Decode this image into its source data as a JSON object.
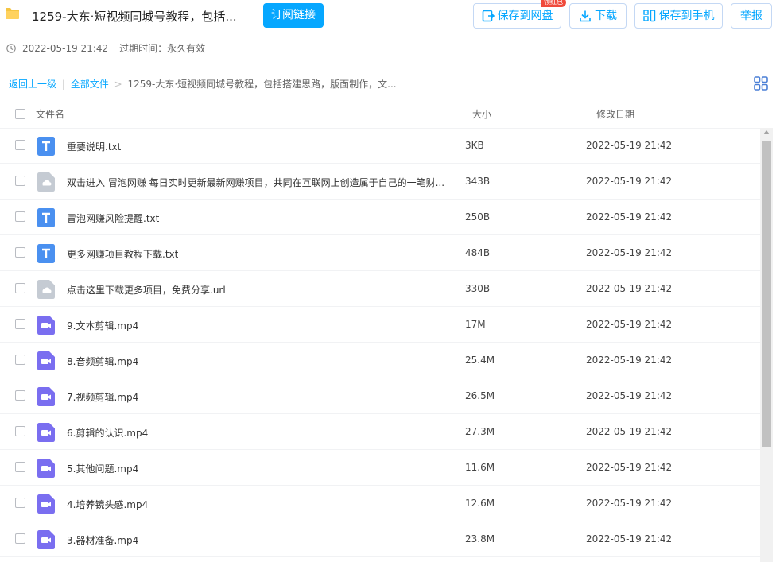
{
  "header": {
    "title": "1259-大东·短视频同城号教程，包括...",
    "subscribe_label": "订阅链接",
    "save_to_disk_label": "保存到网盘",
    "badge_label": "领红包",
    "download_label": "下载",
    "save_to_phone_label": "保存到手机",
    "report_label": "举报",
    "date": "2022-05-19 21:42",
    "expiry": "过期时间：永久有效"
  },
  "breadcrumb": {
    "back": "返回上一级",
    "separator_bar": "|",
    "all_files": "全部文件",
    "arrow": ">",
    "current": "1259-大东·短视频同城号教程，包括搭建思路，版面制作，文..."
  },
  "table": {
    "col_name": "文件名",
    "col_size": "大小",
    "col_date": "修改日期",
    "rows": [
      {
        "name": "重要说明.txt",
        "size": "3KB",
        "date": "2022-05-19 21:42",
        "type": "txt"
      },
      {
        "name": "双击进入 冒泡网赚 每日实时更新最新网赚项目，共同在互联网上创造属于自己的一笔财...",
        "size": "343B",
        "date": "2022-05-19 21:42",
        "type": "url"
      },
      {
        "name": "冒泡网赚风险提醒.txt",
        "size": "250B",
        "date": "2022-05-19 21:42",
        "type": "txt"
      },
      {
        "name": "更多网赚项目教程下载.txt",
        "size": "484B",
        "date": "2022-05-19 21:42",
        "type": "txt"
      },
      {
        "name": "点击这里下载更多项目，免费分享.url",
        "size": "330B",
        "date": "2022-05-19 21:42",
        "type": "url"
      },
      {
        "name": "9.文本剪辑.mp4",
        "size": "17M",
        "date": "2022-05-19 21:42",
        "type": "video"
      },
      {
        "name": "8.音频剪辑.mp4",
        "size": "25.4M",
        "date": "2022-05-19 21:42",
        "type": "video"
      },
      {
        "name": "7.视频剪辑.mp4",
        "size": "26.5M",
        "date": "2022-05-19 21:42",
        "type": "video"
      },
      {
        "name": "6.剪辑的认识.mp4",
        "size": "27.3M",
        "date": "2022-05-19 21:42",
        "type": "video"
      },
      {
        "name": "5.其他问题.mp4",
        "size": "11.6M",
        "date": "2022-05-19 21:42",
        "type": "video"
      },
      {
        "name": "4.培养镜头感.mp4",
        "size": "12.6M",
        "date": "2022-05-19 21:42",
        "type": "video"
      },
      {
        "name": "3.器材准备.mp4",
        "size": "23.8M",
        "date": "2022-05-19 21:42",
        "type": "video"
      }
    ]
  },
  "colors": {
    "accent": "#06a7ff",
    "txt_icon": "#4a90f0",
    "url_icon": "#c5cbd3",
    "video_icon": "#7a6ef0",
    "folder": "#f5c542"
  },
  "icons": {
    "folder": "folder-icon",
    "clock": "clock-icon",
    "save": "save-to-disk-icon",
    "download": "download-icon",
    "phone": "qr-phone-icon",
    "grid": "grid-view-icon",
    "txt": "text-file-icon",
    "url": "link-file-icon",
    "video": "video-file-icon"
  }
}
